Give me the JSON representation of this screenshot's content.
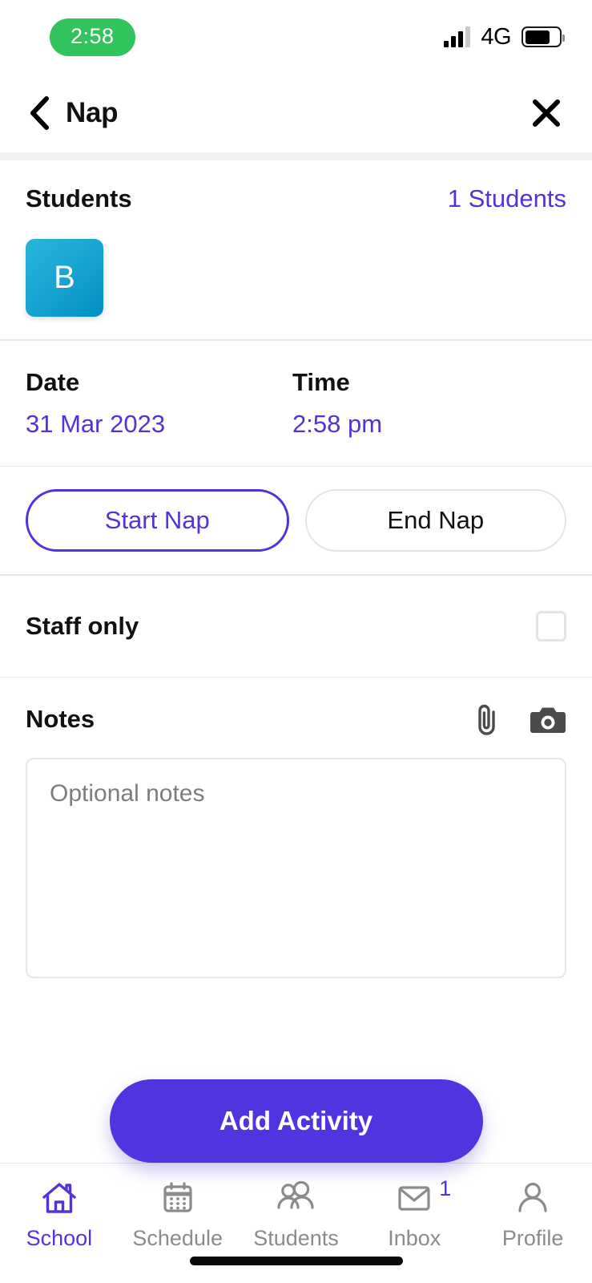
{
  "status_bar": {
    "time": "2:58",
    "network": "4G",
    "time_pill_color": "#32c45c",
    "signal_bars": 4,
    "signal_active": 3,
    "battery_level_pct": 74
  },
  "header": {
    "title": "Nap",
    "back_icon": "chevron-left-icon",
    "close_icon": "close-icon"
  },
  "students": {
    "label": "Students",
    "count_label": "1 Students",
    "avatars": [
      {
        "initial": "B",
        "color_from": "#27b4dc",
        "color_to": "#0090c1"
      }
    ]
  },
  "datetime": {
    "date_label": "Date",
    "date_value": "31 Mar 2023",
    "time_label": "Time",
    "time_value": "2:58 pm"
  },
  "nap_buttons": {
    "start_label": "Start Nap",
    "end_label": "End Nap",
    "selected": "Start Nap"
  },
  "staff_only": {
    "label": "Staff only",
    "checked": false
  },
  "notes": {
    "label": "Notes",
    "placeholder": "Optional notes",
    "value": "",
    "attach_icon": "paperclip-icon",
    "camera_icon": "camera-icon"
  },
  "cta": {
    "label": "Add Activity"
  },
  "tabbar": {
    "items": [
      {
        "label": "School",
        "icon": "home-icon",
        "active": true,
        "badge": ""
      },
      {
        "label": "Schedule",
        "icon": "calendar-icon",
        "active": false,
        "badge": ""
      },
      {
        "label": "Students",
        "icon": "people-icon",
        "active": false,
        "badge": ""
      },
      {
        "label": "Inbox",
        "icon": "envelope-icon",
        "active": false,
        "badge": "1"
      },
      {
        "label": "Profile",
        "icon": "person-icon",
        "active": false,
        "badge": ""
      }
    ]
  },
  "theme": {
    "accent": "#5233e0",
    "link": "#4f33db",
    "muted": "#8b8b8b",
    "border": "#e6e6e8"
  }
}
